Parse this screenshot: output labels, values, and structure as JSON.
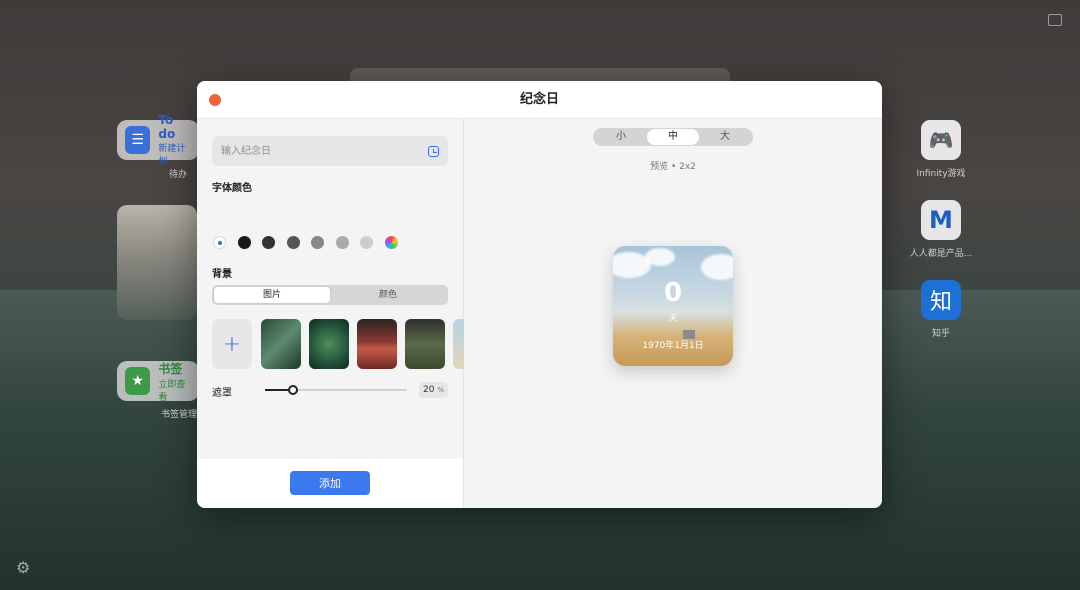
{
  "desktop": {
    "todo_widget": {
      "title": "To do",
      "subtitle": "新建计划",
      "caption": "待办"
    },
    "bookmark_widget": {
      "title": "书签",
      "subtitle": "立即查看",
      "caption": "书签管理"
    },
    "apps": [
      {
        "label": "Infinity游戏",
        "glyph": "🎮",
        "color": "#e8e8e8"
      },
      {
        "label": "人人都是产品...",
        "glyph": "M",
        "color": "#e8e8e8"
      },
      {
        "label": "知乎",
        "glyph": "知",
        "color": "#1e6fd6"
      }
    ]
  },
  "modal": {
    "title": "纪念日",
    "close_color": "#f0643a",
    "input": {
      "placeholder": "输入纪念日",
      "value": ""
    },
    "font_color_label": "字体颜色",
    "font_colors": [
      "#ffffff",
      "#1a1a1a",
      "#333333",
      "#555555",
      "#888888",
      "#aaaaaa",
      "#cccccc",
      "rainbow"
    ],
    "background_label": "背景",
    "background_tabs": {
      "image": "图片",
      "color": "颜色",
      "active": "image"
    },
    "mask_label": "遮罩",
    "mask_value": 20,
    "mask_unit": "%",
    "add_button": "添加",
    "accent": "#3c78ee"
  },
  "preview": {
    "sizes": [
      "小",
      "中",
      "大"
    ],
    "active_size": "中",
    "label": "预览 • 2x2",
    "count": "0",
    "unit": "天",
    "date": "1970年1月1日"
  }
}
